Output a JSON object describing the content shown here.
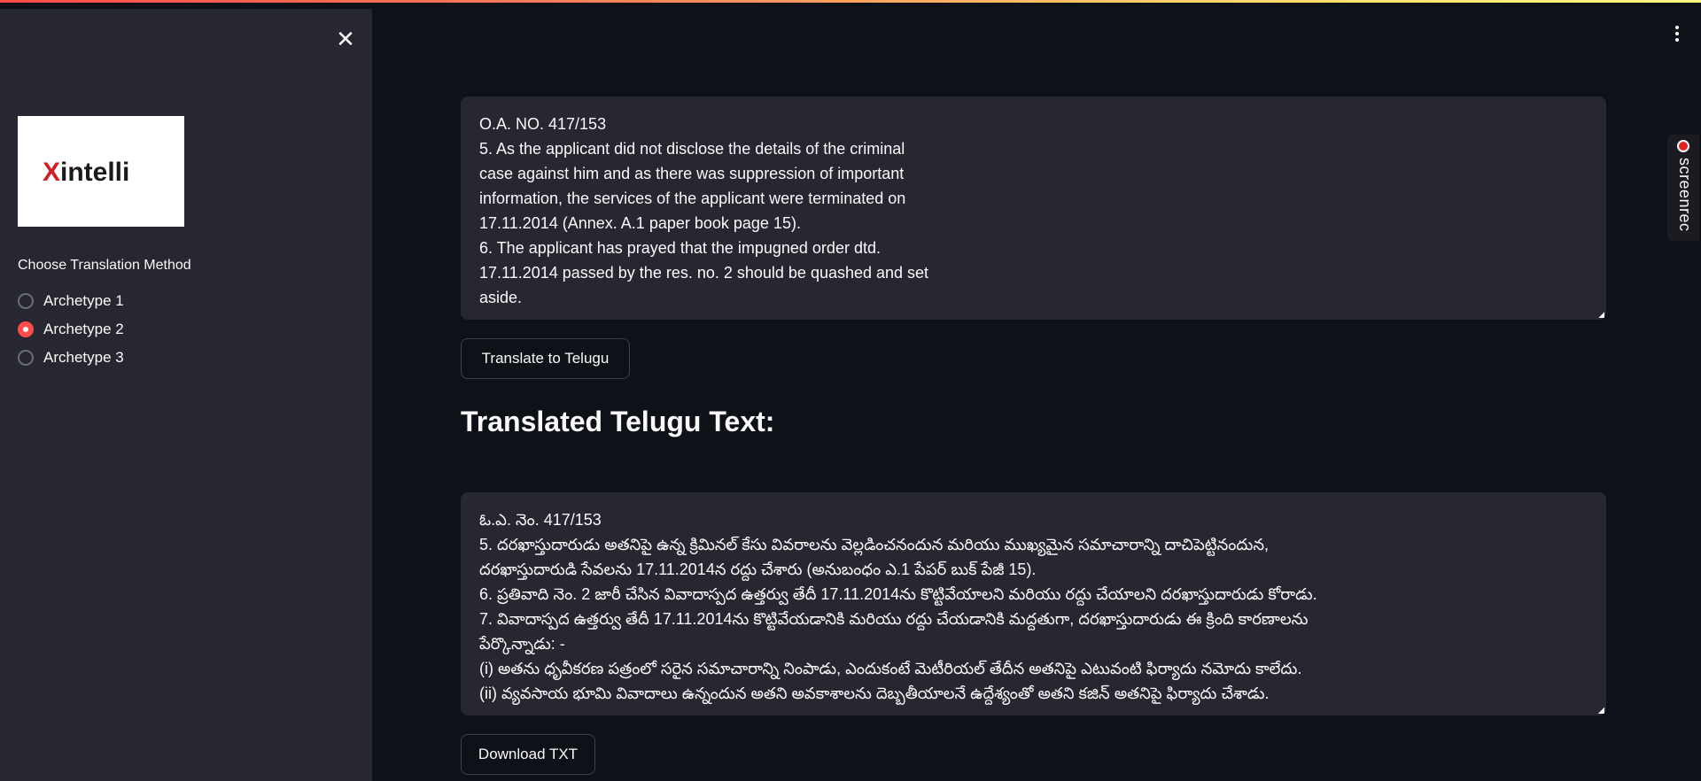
{
  "sidebar": {
    "close_label": "✕",
    "logo": {
      "prefix": "X",
      "rest": "intelli"
    },
    "method_label": "Choose Translation Method",
    "options": [
      {
        "label": "Archetype 1",
        "checked": false
      },
      {
        "label": "Archetype 2",
        "checked": true
      },
      {
        "label": "Archetype 3",
        "checked": false
      }
    ],
    "accent": "#ff4b4b"
  },
  "screenrec": {
    "label": "screenrec"
  },
  "input_text": {
    "lines": [
      "O.A. NO. 417/153",
      "5. As the applicant did not disclose the details of the criminal",
      "case against him and as there was suppression of important",
      "information, the services of the applicant were terminated on",
      "17.11.2014 (Annex. A.1 paper book page 15).",
      "6. The applicant has prayed that the impugned order dtd.",
      "17.11.2014 passed by the res. no. 2 should be quashed and set",
      "aside."
    ]
  },
  "translate_button": {
    "label": "Translate to Telugu"
  },
  "section_title": "Translated Telugu Text:",
  "output_text": {
    "lines": [
      "ఓ.ఎ. నెం. 417/153",
      "5. దరఖాస్తుదారుడు అతనిపై ఉన్న క్రిమినల్ కేసు వివరాలను వెల్లడించనందున మరియు ముఖ్యమైన సమాచారాన్ని దాచిపెట్టినందున,",
      "దరఖాస్తుదారుడి సేవలను 17.11.2014న రద్దు చేశారు (అనుబంధం ఎ.1 పేపర్ బుక్ పేజీ 15).",
      "6. ప్రతివాది నెం. 2 జారీ చేసిన వివాదాస్పద ఉత్తర్వు తేదీ 17.11.2014ను కొట్టివేయాలని మరియు రద్దు చేయాలని దరఖాస్తుదారుడు కోరాడు.",
      "7. వివాదాస్పద ఉత్తర్వు తేదీ 17.11.2014ను కొట్టివేయడానికి మరియు రద్దు చేయడానికి మద్దతుగా, దరఖాస్తుదారుడు ఈ క్రింది కారణాలను",
      "పేర్కొన్నాడు: -",
      "(i) అతను ధృవీకరణ పత్రంలో సరైన సమాచారాన్ని నింపాడు, ఎందుకంటే మెటీరియల్ తేదీన అతనిపై ఎటువంటి ఫిర్యాదు నమోదు కాలేదు.",
      "(ii) వ్యవసాయ భూమి వివాదాలు ఉన్నందున అతని అవకాశాలను దెబ్బతీయాలనే ఉద్దేశ్యంతో అతని కజిన్ అతనిపై ఫిర్యాదు చేశాడు."
    ]
  },
  "download_button": {
    "label": "Download TXT"
  }
}
